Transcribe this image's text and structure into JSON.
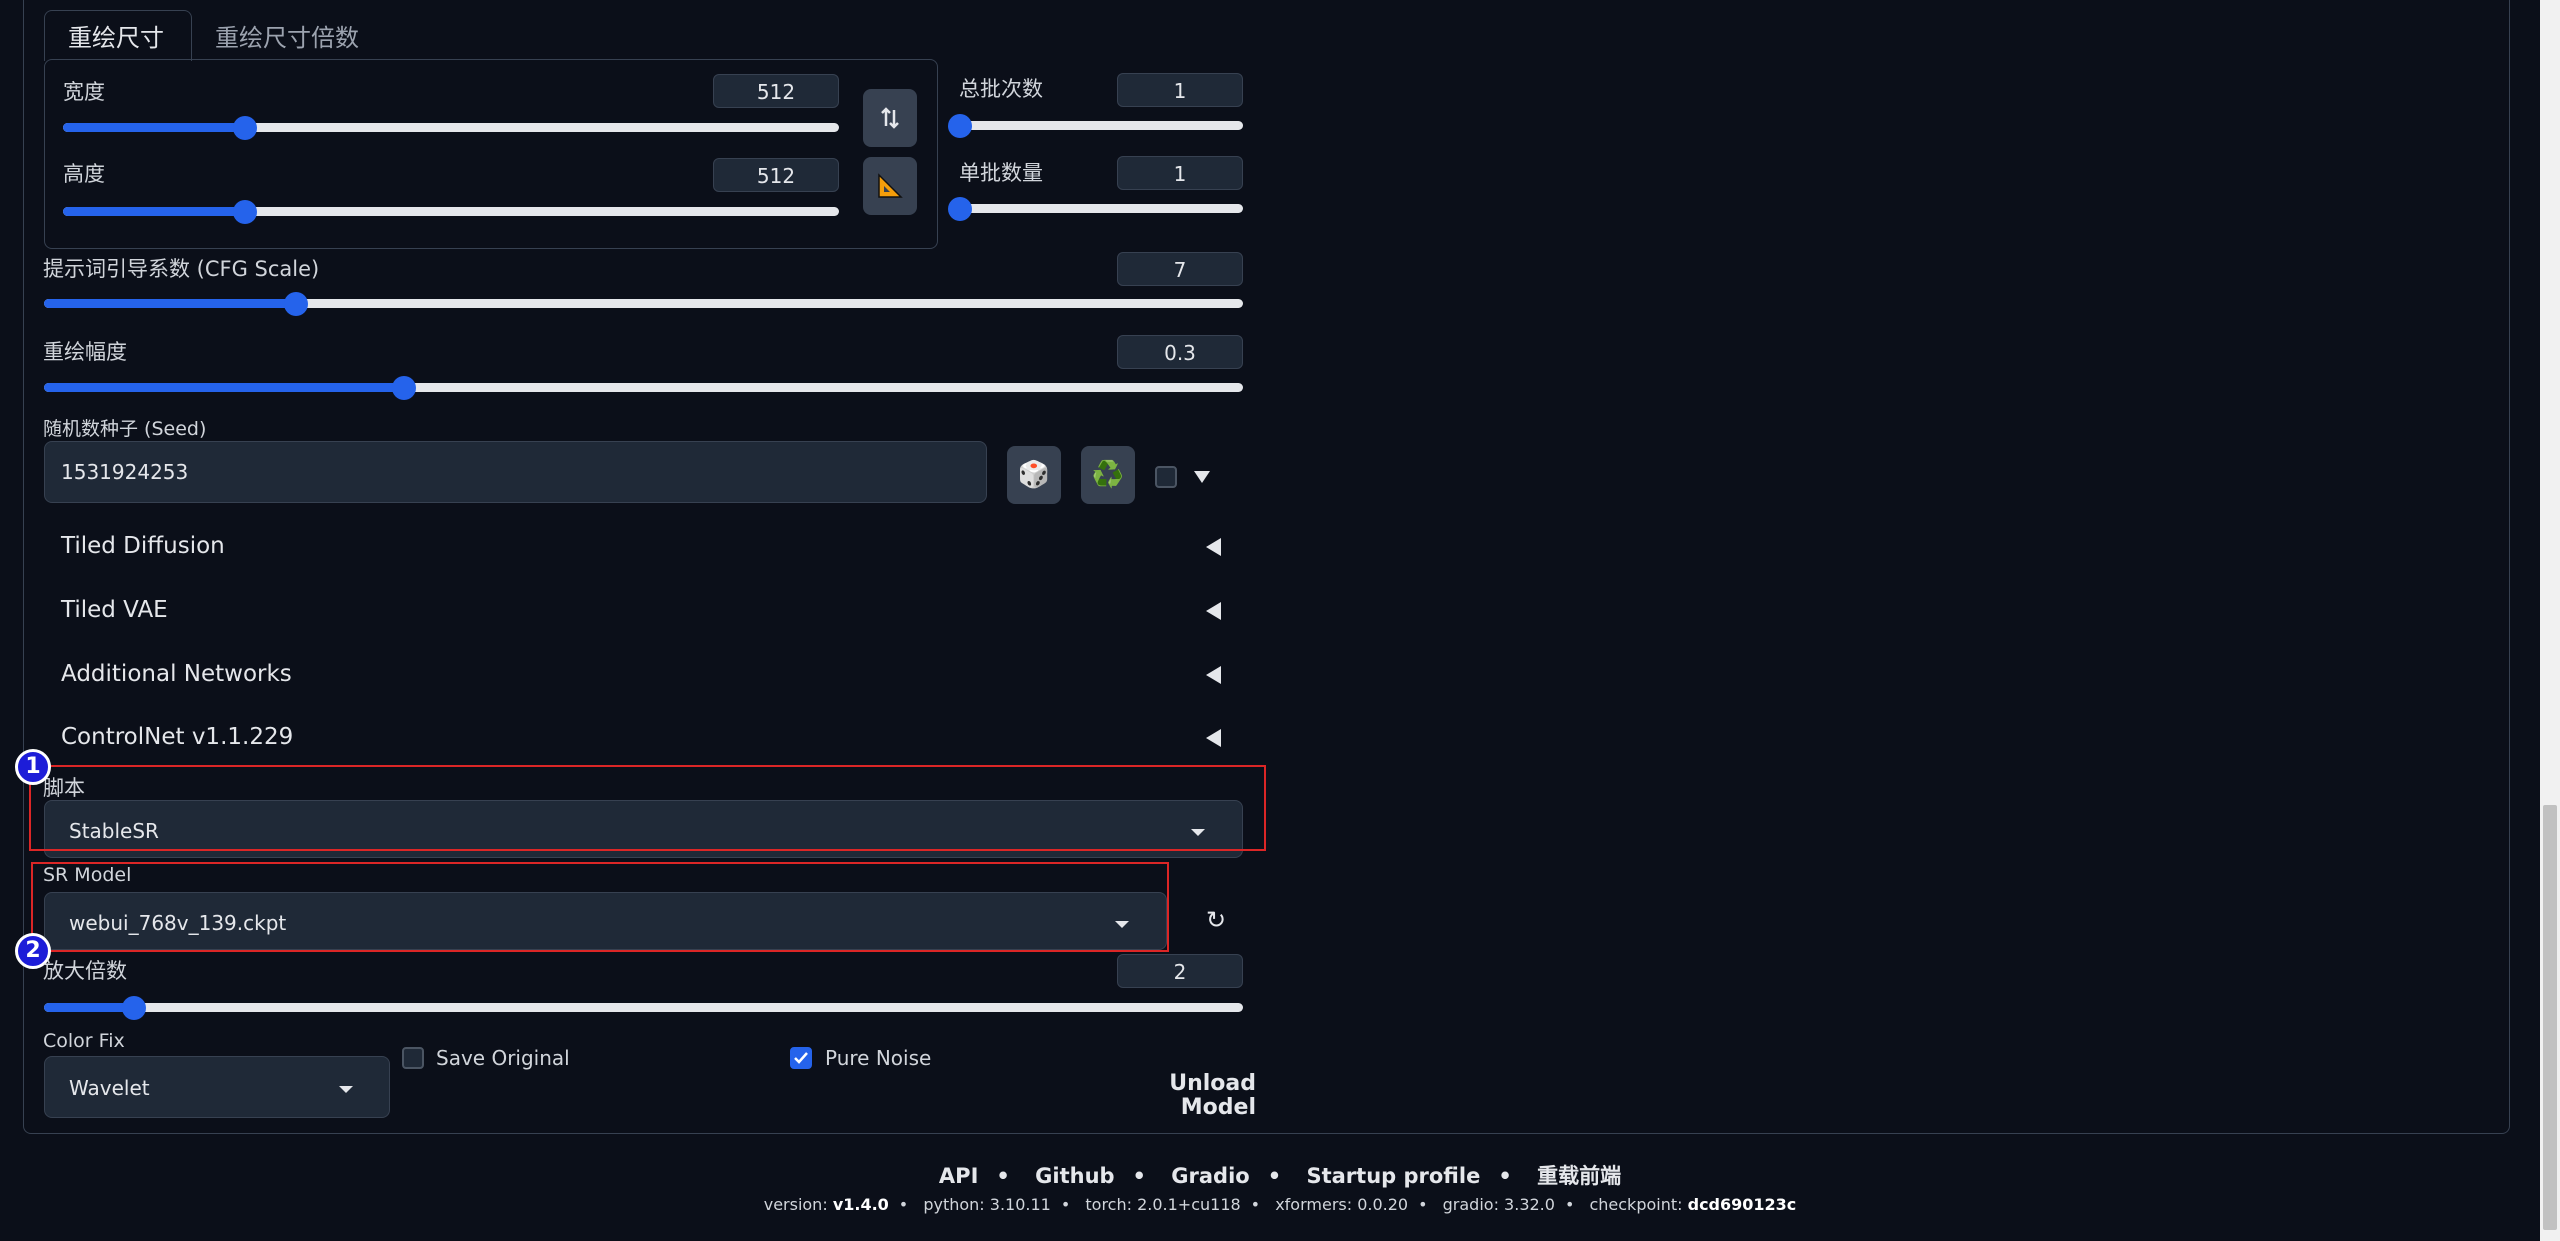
{
  "tabs": [
    {
      "label": "重绘尺寸",
      "active": true
    },
    {
      "label": "重绘尺寸倍数",
      "active": false
    }
  ],
  "size": {
    "width_label": "宽度",
    "width_value": "512",
    "width_fraction": 0.235,
    "height_label": "高度",
    "height_value": "512",
    "height_fraction": 0.235
  },
  "batch": {
    "count_label": "总批次数",
    "count_value": "1",
    "count_fraction": 0.0,
    "size_label": "单批数量",
    "size_value": "1",
    "size_fraction": 0.0
  },
  "cfg": {
    "label": "提示词引导系数 (CFG Scale)",
    "value": "7",
    "fraction": 0.21
  },
  "denoise": {
    "label": "重绘幅度",
    "value": "0.3",
    "fraction": 0.3
  },
  "seed": {
    "label": "随机数种子 (Seed)",
    "value": "1531924253",
    "dice_icon": "🎲",
    "recycle_icon": "♻️"
  },
  "accordions": [
    "Tiled Diffusion",
    "Tiled VAE",
    "Additional Networks",
    "ControlNet v1.1.229"
  ],
  "script": {
    "label": "脚本",
    "value": "StableSR"
  },
  "sr_model": {
    "label": "SR Model",
    "value": "webui_768v_139.ckpt",
    "refresh_icon": "↻"
  },
  "upscale": {
    "label": "放大倍数",
    "value": "2",
    "fraction": 0.075
  },
  "color_fix": {
    "label": "Color Fix",
    "value": "Wavelet"
  },
  "save_original": {
    "label": "Save Original",
    "checked": false
  },
  "pure_noise": {
    "label": "Pure Noise",
    "checked": true
  },
  "unload_model": {
    "line1": "Unload",
    "line2": "Model"
  },
  "annotations": {
    "badge1": "1",
    "badge2": "2"
  },
  "footer": {
    "links": [
      "API",
      "Github",
      "Gradio",
      "Startup profile",
      "重载前端"
    ],
    "version_label": "version:",
    "version": "v1.4.0",
    "python": "python: 3.10.11",
    "torch": "torch: 2.0.1+cu118",
    "xformers": "xformers: 0.0.20",
    "gradio": "gradio: 3.32.0",
    "checkpoint_label": "checkpoint:",
    "checkpoint": "dcd690123c"
  },
  "colors": {
    "accent": "#2563eb",
    "background": "#0b0f19",
    "highlight": "#dc2626",
    "badge": "#1d1dd8"
  }
}
